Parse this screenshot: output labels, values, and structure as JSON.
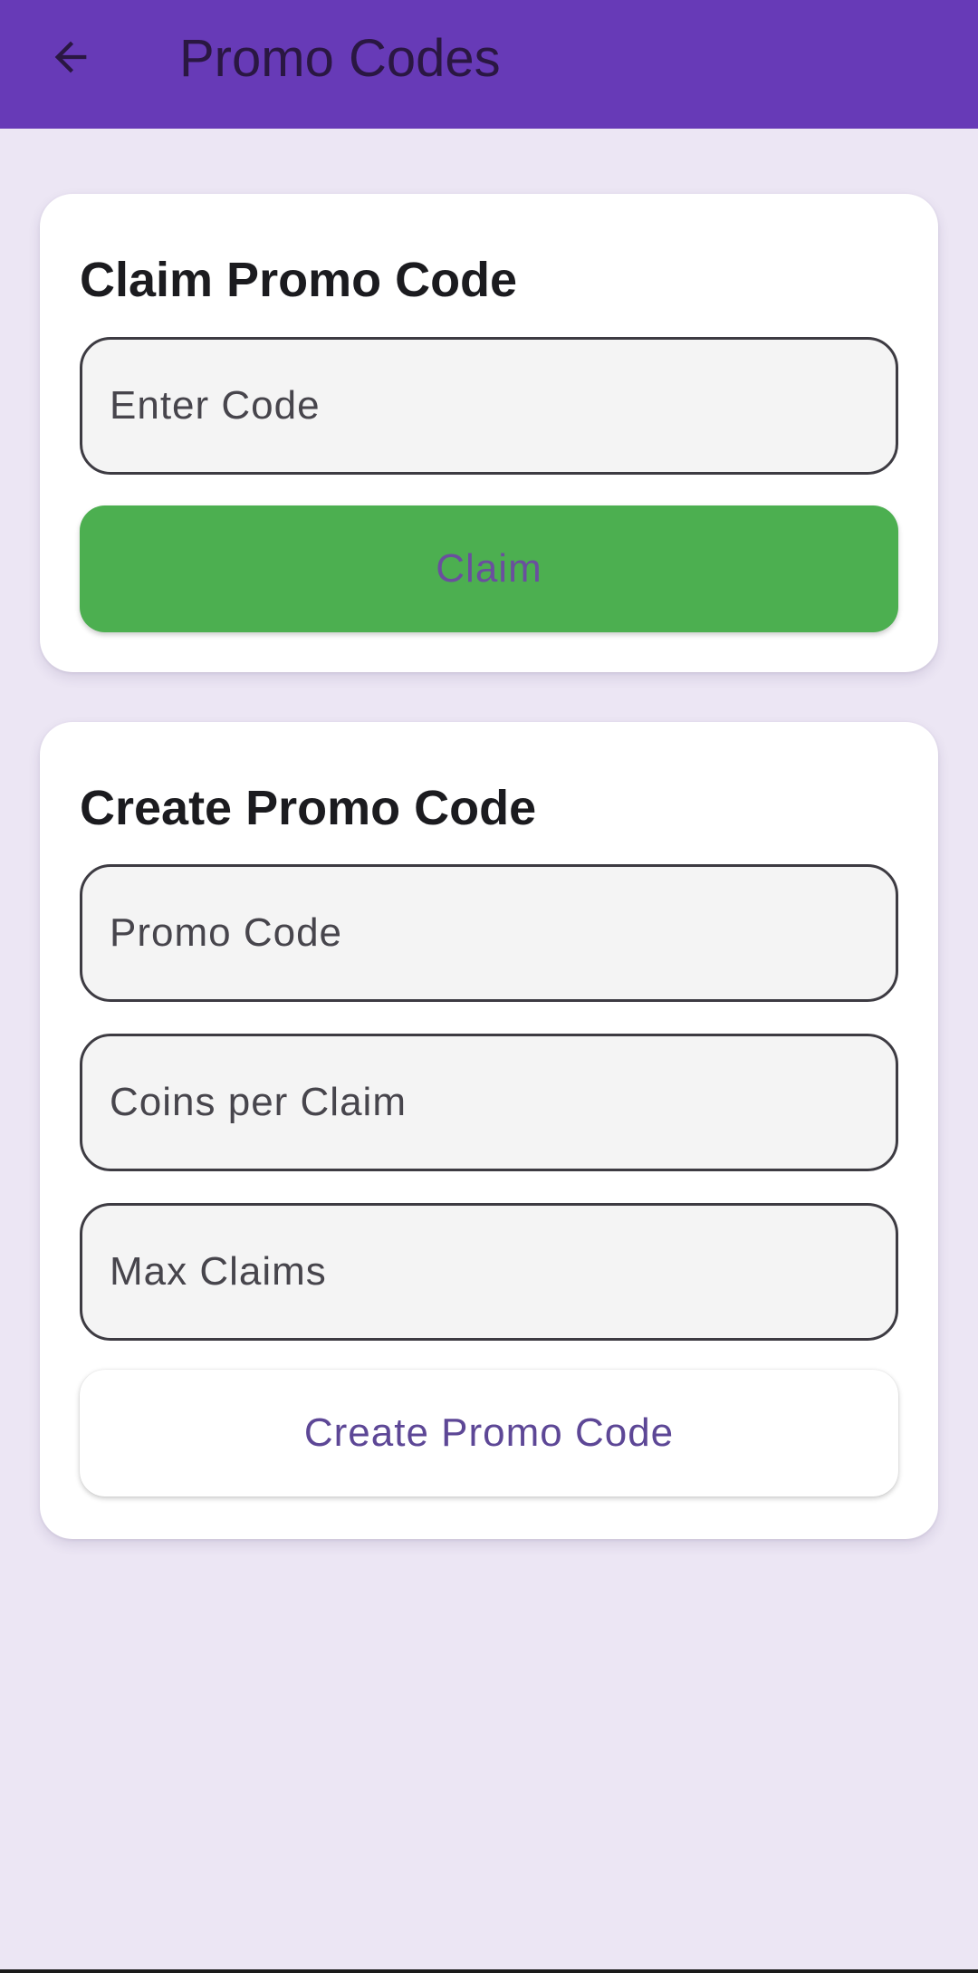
{
  "app_bar": {
    "title": "Promo Codes",
    "back_icon": "arrow-back-icon",
    "background_color": "#673ab7"
  },
  "claim_card": {
    "title": "Claim Promo Code",
    "code_field": {
      "placeholder": "Enter Code",
      "value": ""
    },
    "claim_button_label": "Claim",
    "claim_button_color": "#4caf50"
  },
  "create_card": {
    "title": "Create Promo Code",
    "promo_code_field": {
      "placeholder": "Promo Code",
      "value": ""
    },
    "coins_field": {
      "placeholder": "Coins per Claim",
      "value": ""
    },
    "max_claims_field": {
      "placeholder": "Max Claims",
      "value": ""
    },
    "create_button_label": "Create Promo Code"
  },
  "colors": {
    "page_background": "#ece6f4",
    "card_background": "#ffffff",
    "button_text": "#6a4f9e"
  }
}
